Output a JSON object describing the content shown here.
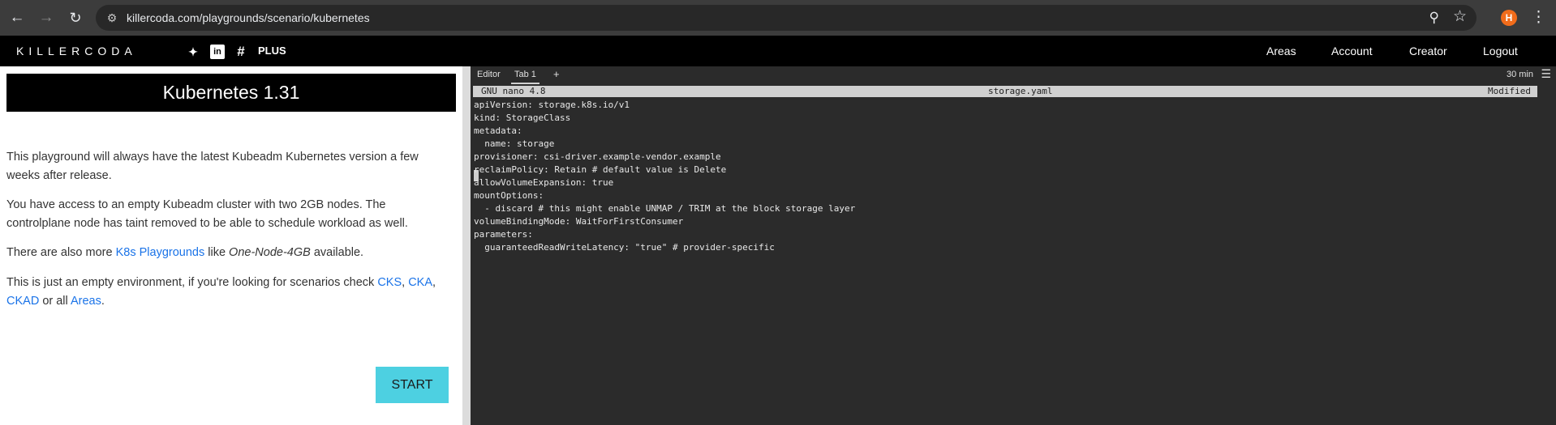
{
  "browser": {
    "url": "killercoda.com/playgrounds/scenario/kubernetes",
    "profile_initial": "H",
    "icons": {
      "back": "arrow-back",
      "forward": "arrow-forward",
      "reload": "reload",
      "site_info": "tune",
      "zoom": "magnifier",
      "bookmark": "star",
      "menu": "kebab"
    }
  },
  "site": {
    "logo": "KILLERCODA",
    "plus": "PLUS",
    "social_icons": [
      "twitter-icon",
      "linkedin-icon",
      "slack-icon"
    ],
    "nav": [
      "Areas",
      "Account",
      "Creator",
      "Logout"
    ]
  },
  "scenario": {
    "title": "Kubernetes 1.31",
    "p1": "This playground will always have the latest Kubeadm Kubernetes version a few weeks after release.",
    "p2": "You have access to an empty Kubeadm cluster with two 2GB nodes. The controlplane node has taint removed to be able to schedule workload as well.",
    "p3": {
      "before": "There are also more ",
      "link": "K8s Playgrounds",
      "middle": " like ",
      "emph": "One-Node-4GB",
      "after": " available."
    },
    "p4": {
      "before": "This is just an empty environment, if you're looking for scenarios check ",
      "link1": "CKS",
      "sep1": ", ",
      "link2": "CKA",
      "sep2": ", ",
      "link3": "CKAD",
      "mid": " or all ",
      "link4": "Areas",
      "end": "."
    },
    "start": "START"
  },
  "editor": {
    "tabs": [
      "Editor",
      "Tab 1"
    ],
    "add_tab": "+",
    "timer": "30 min",
    "menu_icon": "hamburger-icon",
    "nano": {
      "version": "GNU nano 4.8",
      "filename": "storage.yaml",
      "status": "Modified"
    },
    "lines": [
      "apiVersion: storage.k8s.io/v1",
      "kind: StorageClass",
      "metadata:",
      "  name: storage",
      "provisioner: csi-driver.example-vendor.example",
      "reclaimPolicy: Retain # default value is Delete",
      "allowVolumeExpansion: true",
      "mountOptions:",
      "  - discard # this might enable UNMAP / TRIM at the block storage layer",
      "volumeBindingMode: WaitForFirstConsumer",
      "parameters:",
      "  guaranteedReadWriteLatency: \"true\" # provider-specific"
    ]
  }
}
